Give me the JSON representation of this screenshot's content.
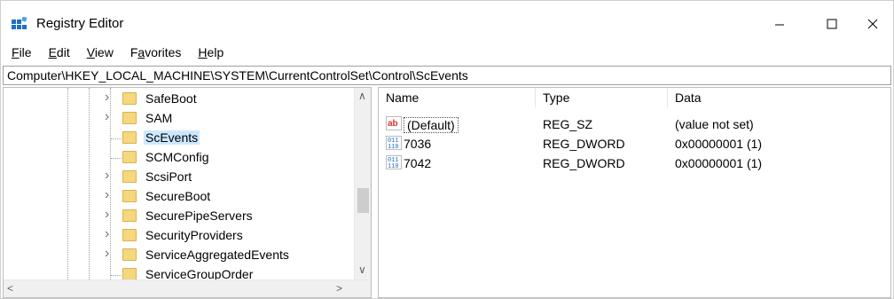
{
  "window": {
    "title": "Registry Editor",
    "controls": {
      "minimize": "—",
      "maximize": "☐",
      "close": "✕"
    }
  },
  "menu": {
    "items": [
      {
        "label": "File",
        "accel": "F",
        "rest": "ile"
      },
      {
        "label": "Edit",
        "accel": "E",
        "rest": "dit"
      },
      {
        "label": "View",
        "accel": "V",
        "rest": "iew"
      },
      {
        "label": "Favorites",
        "pre": "F",
        "accel": "a",
        "rest": "vorites"
      },
      {
        "label": "Help",
        "accel": "H",
        "rest": "elp"
      }
    ]
  },
  "address": {
    "path": "Computer\\HKEY_LOCAL_MACHINE\\SYSTEM\\CurrentControlSet\\Control\\ScEvents"
  },
  "tree": {
    "items": [
      {
        "label": "SafeBoot",
        "expandable": true
      },
      {
        "label": "SAM",
        "expandable": true
      },
      {
        "label": "ScEvents",
        "expandable": false,
        "selected": true
      },
      {
        "label": "SCMConfig",
        "expandable": false
      },
      {
        "label": "ScsiPort",
        "expandable": true
      },
      {
        "label": "SecureBoot",
        "expandable": true
      },
      {
        "label": "SecurePipeServers",
        "expandable": true
      },
      {
        "label": "SecurityProviders",
        "expandable": true
      },
      {
        "label": "ServiceAggregatedEvents",
        "expandable": true
      },
      {
        "label": "ServiceGroupOrder",
        "expandable": false
      }
    ]
  },
  "values": {
    "columns": {
      "name": "Name",
      "type": "Type",
      "data": "Data"
    },
    "rows": [
      {
        "icon": "string-value-icon",
        "name": "(Default)",
        "type": "REG_SZ",
        "data": "(value not set)"
      },
      {
        "icon": "binary-value-icon",
        "name": "7036",
        "type": "REG_DWORD",
        "data": "0x00000001 (1)"
      },
      {
        "icon": "binary-value-icon",
        "name": "7042",
        "type": "REG_DWORD",
        "data": "0x00000001 (1)"
      }
    ]
  },
  "colors": {
    "selection": "#cce8ff",
    "folder": "#f5d77f",
    "icon_blue": "#1e6fc7",
    "icon_red": "#d33"
  }
}
